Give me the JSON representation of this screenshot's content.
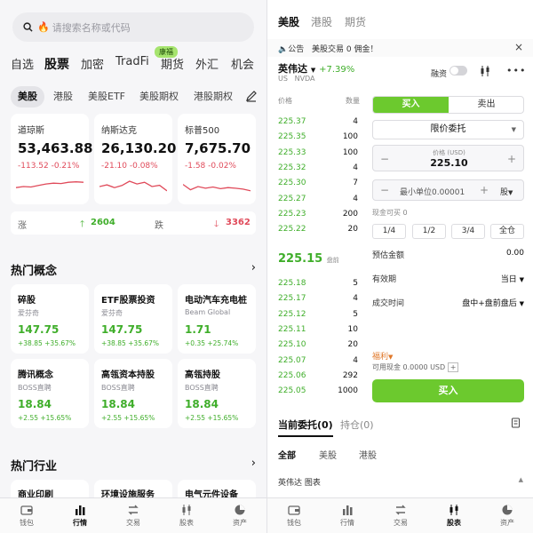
{
  "left": {
    "search_placeholder": "请搜索名称或代码",
    "nav_tabs": [
      "自选",
      "股票",
      "加密",
      "TradFi",
      "期货",
      "外汇",
      "机会"
    ],
    "new_badge": "康福",
    "sub_tabs": [
      "美股",
      "港股",
      "美股ETF",
      "美股期权",
      "港股期权"
    ],
    "indices": [
      {
        "name": "道琼斯",
        "value": "53,463.88",
        "change": "-113.52  -0.21%",
        "spark": [
          0.45,
          0.5,
          0.48,
          0.55,
          0.62,
          0.66,
          0.64,
          0.7,
          0.72,
          0.7
        ]
      },
      {
        "name": "纳斯达克",
        "value": "26,130.20",
        "change": "-21.10  -0.08%",
        "spark": [
          0.5,
          0.58,
          0.45,
          0.55,
          0.75,
          0.62,
          0.7,
          0.5,
          0.56,
          0.3
        ]
      },
      {
        "name": "标普500",
        "value": "7,675.70",
        "change": "-1.58  -0.02%",
        "spark": [
          0.6,
          0.35,
          0.5,
          0.42,
          0.48,
          0.4,
          0.45,
          0.42,
          0.38,
          0.3
        ]
      }
    ],
    "breadth": {
      "up_label": "涨",
      "up_count": "2604",
      "down_label": "跌",
      "down_count": "3362"
    },
    "hot_concepts_title": "热门概念",
    "concepts": [
      {
        "title": "碎股",
        "stock": "爱芬奇",
        "price": "147.75",
        "change": "+38.85  +35.67%"
      },
      {
        "title": "ETF股票投资",
        "stock": "爱芬奇",
        "price": "147.75",
        "change": "+38.85  +35.67%"
      },
      {
        "title": "电动汽车充电桩",
        "stock": "Beam Global",
        "price": "1.71",
        "change": "+0.35  +25.74%"
      },
      {
        "title": "腾讯概念",
        "stock": "BOSS直聘",
        "price": "18.84",
        "change": "+2.55  +15.65%"
      },
      {
        "title": "高瓴资本持股",
        "stock": "BOSS直聘",
        "price": "18.84",
        "change": "+2.55  +15.65%"
      },
      {
        "title": "高瓴持股",
        "stock": "BOSS直聘",
        "price": "18.84",
        "change": "+2.55  +15.65%"
      }
    ],
    "hot_industry_title": "热门行业",
    "industries": [
      "商业印刷",
      "环境设施服务",
      "电气元件设备"
    ],
    "bottom_nav": [
      "钱包",
      "行情",
      "交易",
      "股表",
      "资产"
    ]
  },
  "right": {
    "market_tabs": [
      "美股",
      "港股",
      "期货"
    ],
    "notice_label": "公告",
    "notice_text": "美股交易 0 佣金！",
    "stock_name": "英伟达",
    "stock_change": "+7.39%",
    "stock_region": "US",
    "stock_code": "NVDA",
    "margin_label": "融资",
    "ob_header_price": "价格",
    "ob_header_qty": "数量",
    "asks": [
      {
        "price": "225.37",
        "qty": "4"
      },
      {
        "price": "225.35",
        "qty": "100"
      },
      {
        "price": "225.33",
        "qty": "100"
      },
      {
        "price": "225.32",
        "qty": "4"
      },
      {
        "price": "225.30",
        "qty": "7"
      },
      {
        "price": "225.27",
        "qty": "4"
      },
      {
        "price": "225.23",
        "qty": "200"
      },
      {
        "price": "225.22",
        "qty": "20"
      }
    ],
    "last_price": "225.15",
    "last_price_tag": "盘前",
    "bids": [
      {
        "price": "225.18",
        "qty": "5"
      },
      {
        "price": "225.17",
        "qty": "4"
      },
      {
        "price": "225.12",
        "qty": "5"
      },
      {
        "price": "225.11",
        "qty": "10"
      },
      {
        "price": "225.10",
        "qty": "20"
      },
      {
        "price": "225.07",
        "qty": "4"
      },
      {
        "price": "225.06",
        "qty": "292"
      },
      {
        "price": "225.05",
        "qty": "1000"
      }
    ],
    "buy_tab": "买入",
    "sell_tab": "卖出",
    "order_type": "限价委托",
    "price_label": "价格 (USD)",
    "price_value": "225.10",
    "qty_placeholder": "最小单位0.00001",
    "qty_unit": "股",
    "available": "现金可买  0",
    "ratios": [
      "1/4",
      "1/2",
      "3/4",
      "全仓"
    ],
    "est_label": "预估金额",
    "est_value": "0.00",
    "valid_label": "有效期",
    "valid_value": "当日",
    "session_label": "成交时间",
    "session_value": "盘中+盘前盘后",
    "welfare_label": "福利",
    "cash_label": "可用现金  0.0000 USD",
    "buy_button": "买入",
    "order_tabs": [
      "当前委托(0)",
      "持仓(0)"
    ],
    "filters": [
      "全部",
      "美股",
      "港股"
    ],
    "chart_row": "英伟达 图表",
    "bottom_nav": [
      "钱包",
      "行情",
      "交易",
      "股表",
      "资产"
    ]
  },
  "colors": {
    "up": "#3fae2a",
    "down": "#e04a5a",
    "accent": "#6cc92e"
  }
}
